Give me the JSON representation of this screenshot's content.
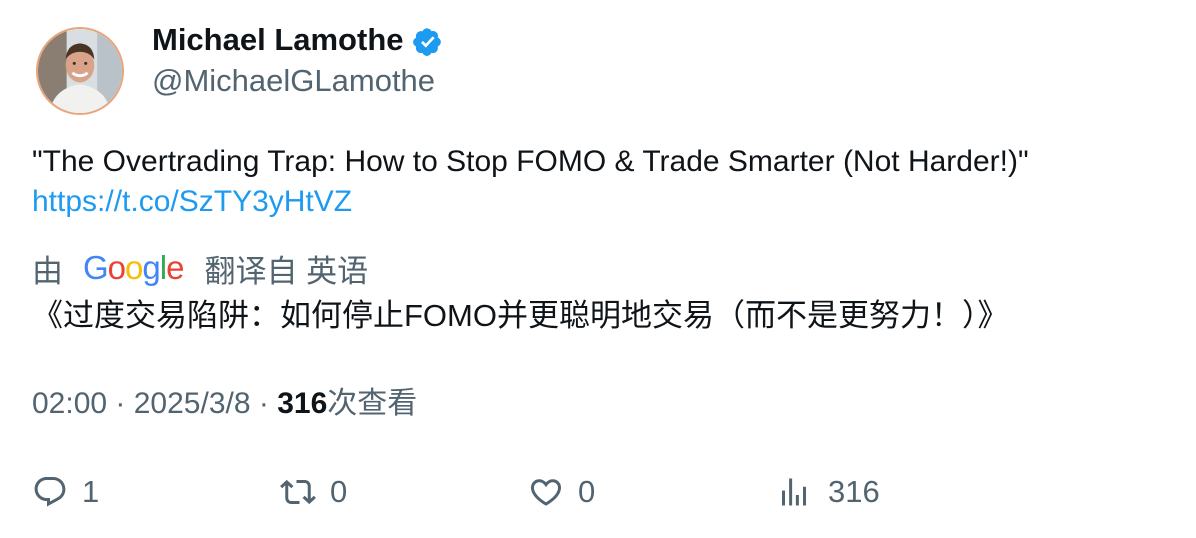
{
  "author": {
    "display_name": "Michael Lamothe",
    "handle": "@MichaelGLamothe",
    "verified": true
  },
  "tweet": {
    "text": "\"The Overtrading Trap: How to Stop FOMO & Trade Smarter (Not Harder!)\"",
    "link": "https://t.co/SzTY3yHtVZ"
  },
  "translation": {
    "by_label": "由",
    "provider_logo_letters": [
      {
        "char": "G",
        "color": "#4285f4"
      },
      {
        "char": "o",
        "color": "#ea4335"
      },
      {
        "char": "o",
        "color": "#fbbc05"
      },
      {
        "char": "g",
        "color": "#4285f4"
      },
      {
        "char": "l",
        "color": "#34a853"
      },
      {
        "char": "e",
        "color": "#ea4335"
      }
    ],
    "translated_from_label": "翻译自 英语",
    "translated_text": "《过度交易陷阱：如何停止FOMO并更聪明地交易（而不是更努力！）》"
  },
  "meta": {
    "time": "02:00",
    "separator": " · ",
    "date": "2025/3/8",
    "views_count": "316",
    "views_label": "次查看"
  },
  "actions": {
    "reply": {
      "icon": "reply-icon",
      "count": "1"
    },
    "retweet": {
      "icon": "retweet-icon",
      "count": "0"
    },
    "like": {
      "icon": "heart-icon",
      "count": "0"
    },
    "views": {
      "icon": "analytics-icon",
      "count": "316"
    }
  },
  "colors": {
    "text_primary": "#0f1419",
    "text_secondary": "#536471",
    "link": "#1d9bf0",
    "verified_badge": "#1d9bf0",
    "avatar_ring": "#e9a47a"
  }
}
